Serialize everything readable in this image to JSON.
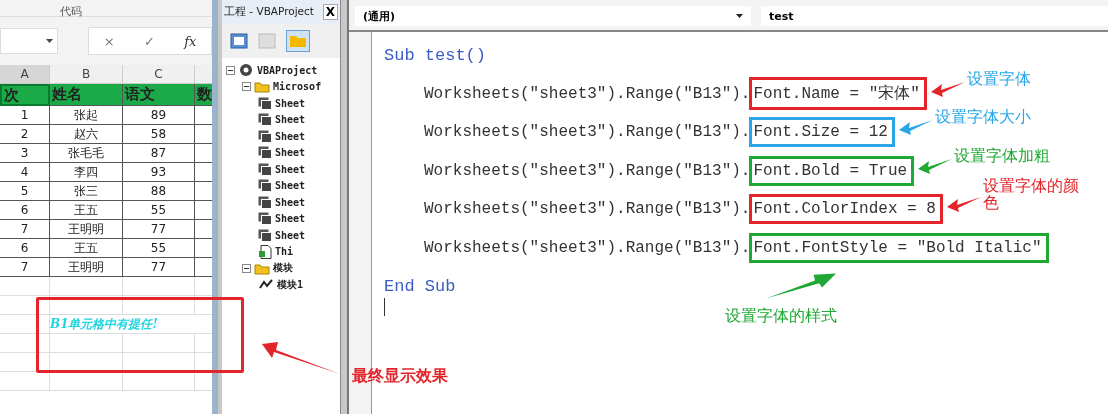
{
  "excel": {
    "ribbon_label": "代码",
    "formula_bar": {
      "cancel": "×",
      "enter": "✓",
      "fx": "fx"
    },
    "columns": [
      "A",
      "B",
      "C"
    ],
    "header": [
      "次",
      "姓名",
      "语文",
      "数"
    ],
    "rows": [
      [
        "1",
        "张起",
        "89"
      ],
      [
        "2",
        "赵六",
        "58"
      ],
      [
        "3",
        "张毛毛",
        "87"
      ],
      [
        "4",
        "李四",
        "93"
      ],
      [
        "5",
        "张三",
        "88"
      ],
      [
        "6",
        "王五",
        "55"
      ],
      [
        "7",
        "王明明",
        "77"
      ],
      [
        "6",
        "王五",
        "55"
      ],
      [
        "7",
        "王明明",
        "77"
      ]
    ],
    "result_text": "B1单元格中有提任!",
    "result_note": "最终显示效果"
  },
  "project": {
    "title": "工程 - VBAProject",
    "close": "X",
    "tree": [
      {
        "label": "VBAProject",
        "kind": "project",
        "expanded": true,
        "children": [
          {
            "label": "Microsof",
            "kind": "folder",
            "expanded": true,
            "children": [
              {
                "label": "Sheet",
                "kind": "sheet"
              },
              {
                "label": "Sheet",
                "kind": "sheet"
              },
              {
                "label": "Sheet",
                "kind": "sheet"
              },
              {
                "label": "Sheet",
                "kind": "sheet"
              },
              {
                "label": "Sheet",
                "kind": "sheet"
              },
              {
                "label": "Sheet",
                "kind": "sheet"
              },
              {
                "label": "Sheet",
                "kind": "sheet"
              },
              {
                "label": "Sheet",
                "kind": "sheet"
              },
              {
                "label": "Sheet",
                "kind": "sheet"
              },
              {
                "label": "Thi",
                "kind": "workbook"
              }
            ]
          },
          {
            "label": "模块",
            "kind": "folder",
            "expanded": true,
            "children": [
              {
                "label": "模块1",
                "kind": "module"
              }
            ]
          }
        ]
      }
    ]
  },
  "code": {
    "object_dropdown": "(通用)",
    "procedure_dropdown": "test",
    "lines": [
      {
        "kind": "keyword",
        "text": "Sub test()"
      },
      {
        "kind": "statement",
        "prefix": "Worksheets(\"sheet3\").Range(\"B13\").",
        "boxed": "Font.Name = \"宋体\"",
        "color": "#e3242b",
        "note": {
          "text": "设置字体",
          "color": "#2aa5e8"
        }
      },
      {
        "kind": "statement",
        "prefix": "Worksheets(\"sheet3\").Range(\"B13\").",
        "boxed": "Font.Size = 12",
        "color": "#2aa5e8",
        "note": {
          "text": "设置字体大小",
          "color": "#2aa5e8"
        }
      },
      {
        "kind": "statement",
        "prefix": "Worksheets(\"sheet3\").Range(\"B13\").",
        "boxed": "Font.Bold = True",
        "color": "#1fa833",
        "note": {
          "text": "设置字体加粗",
          "color": "#1fa833"
        }
      },
      {
        "kind": "statement",
        "prefix": "Worksheets(\"sheet3\").Range(\"B13\").",
        "boxed": "Font.ColorIndex = 8",
        "color": "#e3242b",
        "note": {
          "text": "设置字体的颜色",
          "color": "#e3242b"
        }
      },
      {
        "kind": "statement",
        "prefix": "Worksheets(\"sheet3\").Range(\"B13\").",
        "boxed": "Font.FontStyle = \"Bold Italic\"",
        "color": "#1fa833"
      },
      {
        "kind": "keyword",
        "text": "End Sub"
      }
    ],
    "bottom_note": {
      "text": "设置字体的样式",
      "color": "#1fa833"
    }
  }
}
